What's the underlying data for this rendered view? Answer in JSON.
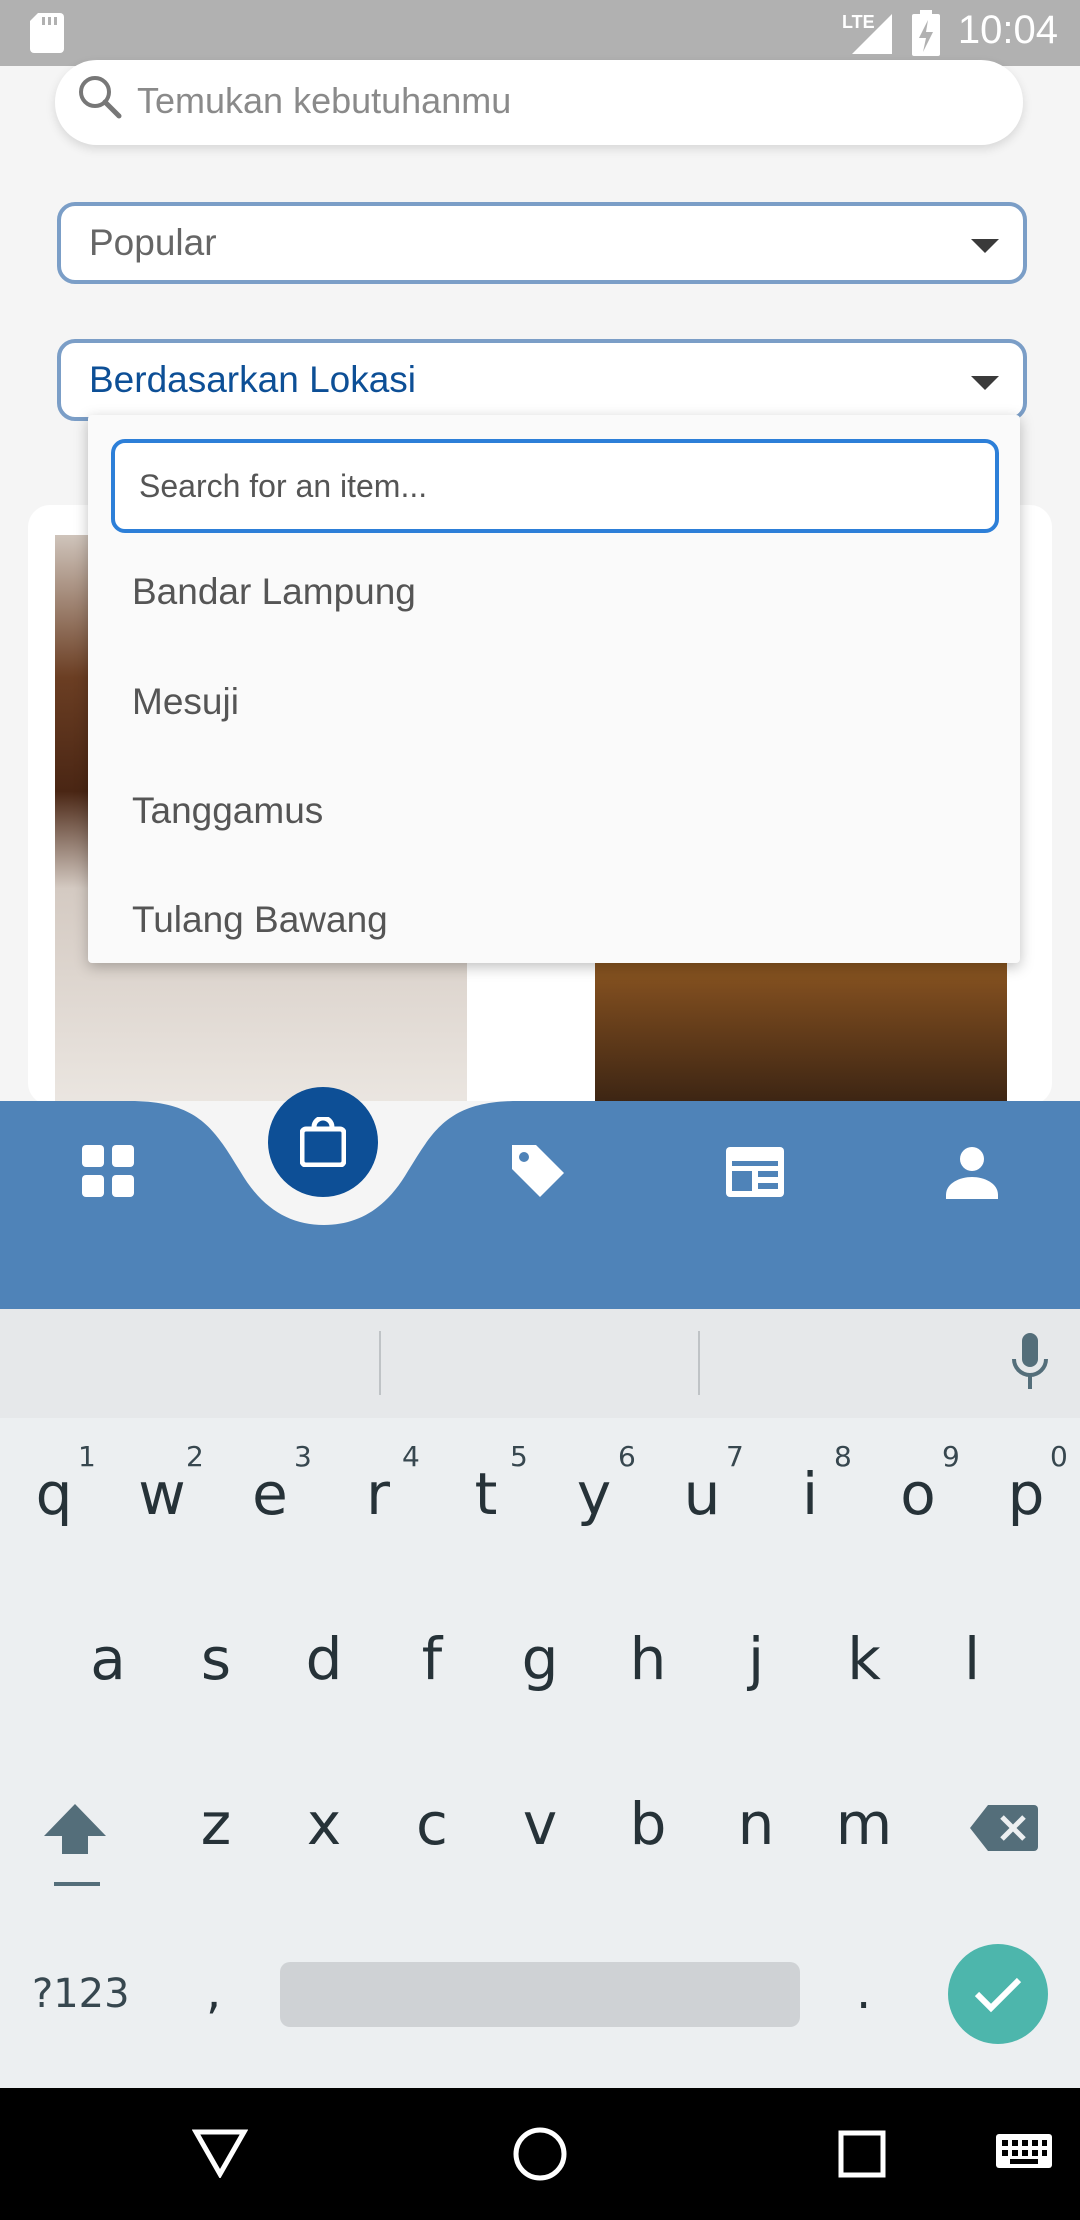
{
  "status_bar": {
    "time": "10:04",
    "network": "LTE"
  },
  "search": {
    "placeholder": "Temukan kebutuhanmu"
  },
  "filters": {
    "sort_value": "Popular",
    "location_value": "Berdasarkan Lokasi"
  },
  "location_popup": {
    "search_placeholder": "Search for an item...",
    "options": [
      "Bandar Lampung",
      "Mesuji",
      "Tanggamus",
      "Tulang Bawang"
    ]
  },
  "bottom_nav": {
    "items": [
      "dashboard-icon",
      "shopping-bag-icon",
      "tag-icon",
      "news-icon",
      "person-icon"
    ],
    "active": "shopping-bag-icon"
  },
  "keyboard": {
    "row1": [
      "q",
      "w",
      "e",
      "r",
      "t",
      "y",
      "u",
      "i",
      "o",
      "p"
    ],
    "row1_numbers": [
      "1",
      "2",
      "3",
      "4",
      "5",
      "6",
      "7",
      "8",
      "9",
      "0"
    ],
    "row2": [
      "a",
      "s",
      "d",
      "f",
      "g",
      "h",
      "j",
      "k",
      "l"
    ],
    "row3": [
      "z",
      "x",
      "c",
      "v",
      "b",
      "n",
      "m"
    ],
    "symbols_key": "?123",
    "comma": ",",
    "period": "."
  },
  "colors": {
    "accent": "#4f83b8",
    "fab": "#0d4f96",
    "popup_border": "#2d7fd8",
    "enter": "#4db6ac"
  }
}
